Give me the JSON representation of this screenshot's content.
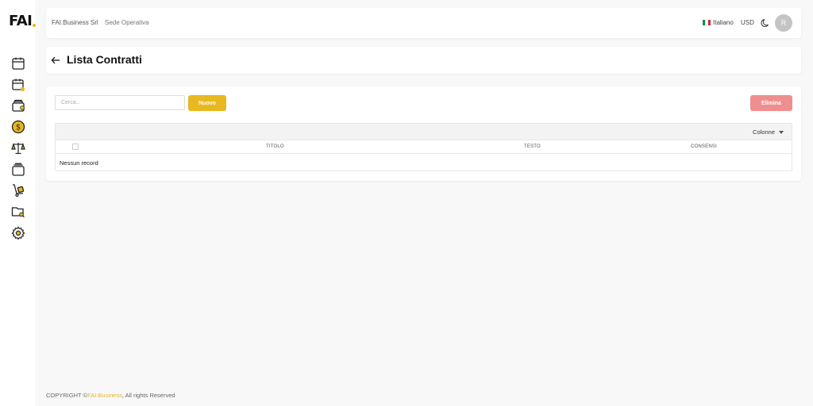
{
  "sidebar": {
    "logo_text": "FAI",
    "items": [
      {
        "icon": "calendar-icon"
      },
      {
        "icon": "calendar-user-icon"
      },
      {
        "icon": "wallet-icon"
      },
      {
        "icon": "dollar-circle-icon"
      },
      {
        "icon": "scale-icon"
      },
      {
        "icon": "layers-icon"
      },
      {
        "icon": "hand-truck-icon"
      },
      {
        "icon": "folder-search-icon"
      },
      {
        "icon": "settings-icon"
      }
    ]
  },
  "header": {
    "company": "FAI.Business Srl",
    "site": "Sede Operativa",
    "language": "Italiano",
    "currency": "USD",
    "avatar_initial": "R"
  },
  "page": {
    "title": "Lista Contratti"
  },
  "toolbar": {
    "search_placeholder": "Cerca...",
    "new_label": "Nuovo",
    "delete_label": "Elimina"
  },
  "table": {
    "columns_label": "Colonne",
    "headers": [
      "TITOLO",
      "TESTO",
      "CONSENSI"
    ],
    "empty_text": "Nessun record"
  },
  "footer": {
    "prefix": "COPYRIGHT ©",
    "brand": "FAI.Business",
    "suffix": ", All rights Reserved"
  },
  "colors": {
    "accent": "#e8b820",
    "danger": "#ef8e8e",
    "background": "#f8f8f8"
  }
}
